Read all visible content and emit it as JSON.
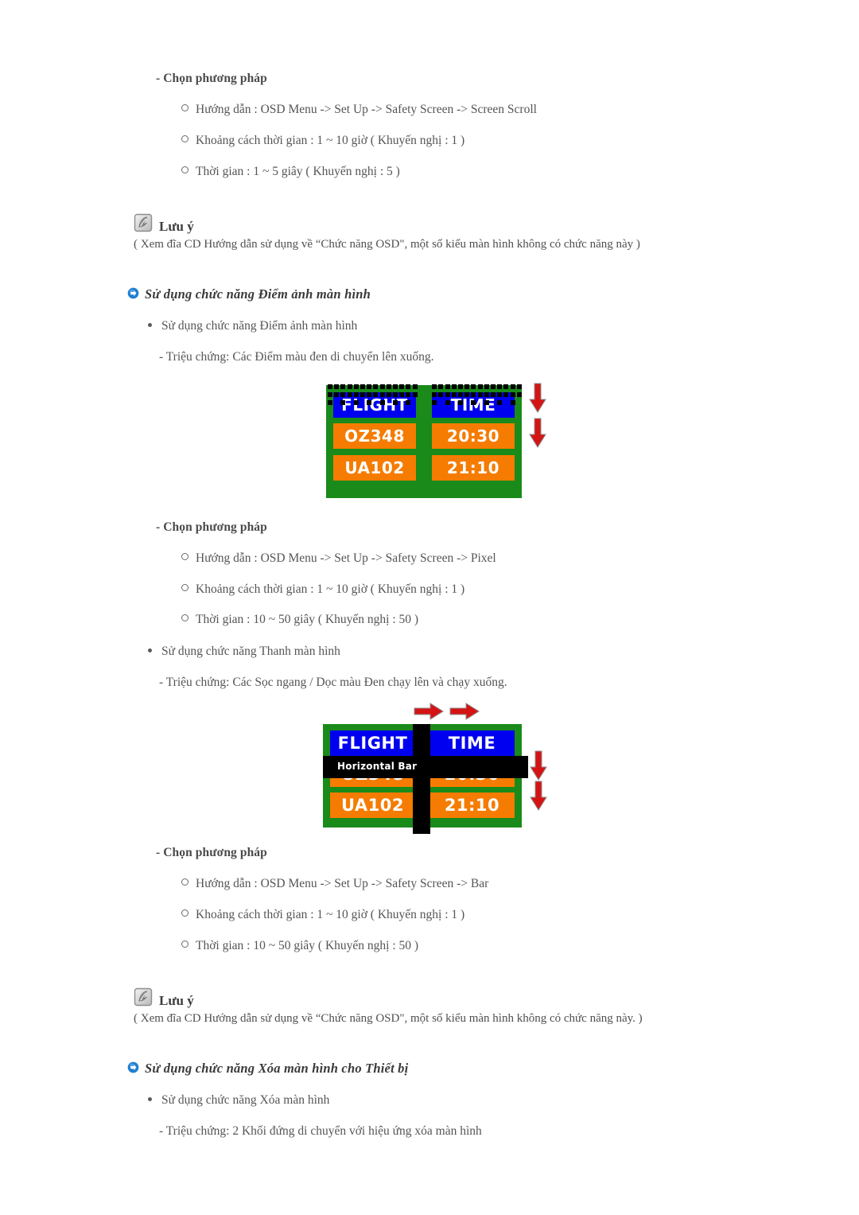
{
  "page": {
    "background": "#ffffff",
    "accent_blue": "#0b6fc4",
    "text_color": "#4f4f4f"
  },
  "sections": {
    "scroll_method": {
      "title": "- Chọn phương pháp",
      "items": [
        "Hướng dẫn : OSD Menu -> Set Up -> Safety Screen -> Screen Scroll",
        "Khoảng cách thời gian : 1 ~ 10 giờ ( Khuyến nghị : 1 )",
        "Thời gian : 1 ~ 5 giây ( Khuyến nghị : 5 )"
      ]
    },
    "note_1": {
      "icon": "note-pencil-icon",
      "label": "Lưu ý",
      "text": "( Xem đĩa CD Hướng dẫn sử dụng về “Chức năng OSD\", một số kiểu màn hình không có chức năng này )"
    },
    "pixel_heading": {
      "icon": "blue-arrow-bullet-icon",
      "text": "Sử dụng chức năng Điểm ảnh màn hình"
    },
    "pixel_bullet": "Sử dụng chức năng Điểm ảnh màn hình",
    "pixel_symptom": "- Triệu chứng: Các Điểm màu đen di chuyển lên xuống.",
    "pixel_method": {
      "title": "- Chọn phương pháp",
      "items": [
        "Hướng dẫn : OSD Menu -> Set Up -> Safety Screen -> Pixel",
        "Khoảng cách thời gian : 1 ~ 10 giờ ( Khuyến nghị : 1 )",
        "Thời gian : 10 ~ 50 giây ( Khuyến nghị : 50 )"
      ]
    },
    "bar_bullet": "Sử dụng chức năng Thanh màn hình",
    "bar_symptom": "- Triệu chứng: Các Sọc ngang / Dọc màu Đen chạy lên và chạy xuống.",
    "bar_method": {
      "title": "- Chọn phương pháp",
      "items": [
        "Hướng dẫn : OSD Menu -> Set Up -> Safety Screen -> Bar",
        "Khoảng cách thời gian : 1 ~ 10 giờ ( Khuyến nghị : 1 )",
        "Thời gian : 10 ~ 50 giây ( Khuyến nghị : 50 )"
      ]
    },
    "note_2": {
      "icon": "note-pencil-icon",
      "label": "Lưu ý",
      "text": "( Xem đĩa CD Hướng dẫn sử dụng về “Chức năng OSD\", một số kiểu màn hình không có chức năng này. )"
    },
    "eraser_heading": {
      "icon": "blue-arrow-bullet-icon",
      "text": "Sử dụng chức năng Xóa màn hình cho Thiết bị"
    },
    "eraser_bullet": "Sử dụng chức năng Xóa màn hình",
    "eraser_symptom": "- Triệu chứng: 2 Khối đứng di chuyển với hiệu ứng xóa màn hình"
  },
  "figure_pixel": {
    "name": "flight-board-pixel",
    "colors": {
      "border": "#1a8a1a",
      "header": "#0000f0",
      "row": "#f57c00",
      "dot": "#000000",
      "arrow": "#d41414"
    },
    "cells": {
      "header_left": "FLIGHT",
      "header_right": "TIME",
      "row1_left": "OZ348",
      "row1_right": "20:30",
      "row2_left": "UA102",
      "row2_right": "21:10"
    },
    "arrows": [
      "down-arrow-icon",
      "down-arrow-icon"
    ]
  },
  "figure_bar": {
    "name": "flight-board-bar",
    "colors": {
      "border": "#1a8a1a",
      "header": "#0000f0",
      "row": "#f57c00",
      "bar": "#000000",
      "arrow": "#d41414"
    },
    "cells": {
      "header_left": "FLIGHT",
      "header_right": "TIME",
      "row1_left": "OZ348",
      "row1_right": "20:30",
      "row2_left": "UA102",
      "row2_right": "21:10"
    },
    "bar_label": "Horizontal Bar",
    "arrows_top": [
      "right-arrow-icon",
      "right-arrow-icon"
    ],
    "arrows_side": [
      "down-arrow-icon",
      "down-arrow-icon"
    ]
  }
}
